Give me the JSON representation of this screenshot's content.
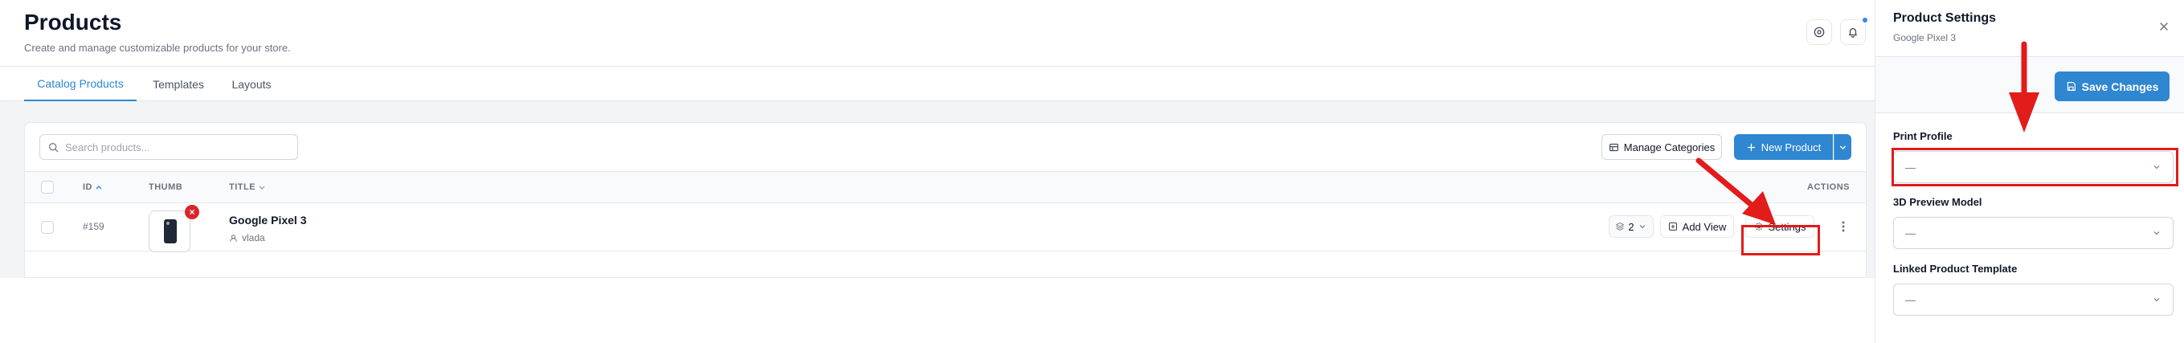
{
  "header": {
    "title": "Products",
    "subtitle": "Create and manage customizable products for your store."
  },
  "tabs": [
    {
      "label": "Catalog Products",
      "active": true
    },
    {
      "label": "Templates",
      "active": false
    },
    {
      "label": "Layouts",
      "active": false
    }
  ],
  "toolbar": {
    "search_placeholder": "Search products...",
    "manage_categories_label": "Manage Categories",
    "new_product_label": "New Product"
  },
  "table": {
    "columns": {
      "id": "ID",
      "thumb": "THUMB",
      "title": "TITLE",
      "actions": "ACTIONS"
    },
    "rows": [
      {
        "id": "#159",
        "title": "Google Pixel 3",
        "owner": "vlada",
        "layers_count": "2",
        "add_view_label": "Add View",
        "settings_label": "Settings"
      }
    ]
  },
  "panel": {
    "title": "Product Settings",
    "subtitle": "Google Pixel 3",
    "save_label": "Save Changes",
    "fields": [
      {
        "label": "Print Profile",
        "value": "—"
      },
      {
        "label": "3D Preview Model",
        "value": "—"
      },
      {
        "label": "Linked Product Template",
        "value": "—"
      }
    ]
  },
  "colors": {
    "accent": "#2f86d1",
    "annotation": "#e21b1b",
    "danger": "#dc2626"
  }
}
